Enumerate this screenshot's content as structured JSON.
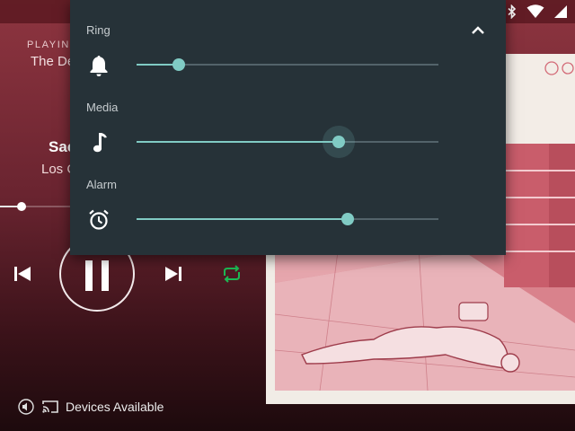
{
  "status_bar": {
    "icons": [
      "bluetooth-icon",
      "wifi-icon",
      "cellular-signal-icon"
    ]
  },
  "player": {
    "playing_from_label": "PLAYING",
    "playing_from_name": "The De",
    "track_title": "Sac",
    "track_artist": "Los C",
    "progress": 0.3,
    "repeat_color": "#1db954"
  },
  "bottom_bar": {
    "devices_label": "Devices Available"
  },
  "volume_panel": {
    "accent_color": "#80cbc4",
    "background_color": "#263238",
    "sliders": [
      {
        "label": "Ring",
        "icon": "bell-icon",
        "level": 0.14
      },
      {
        "label": "Media",
        "icon": "music-note-icon",
        "level": 0.67
      },
      {
        "label": "Alarm",
        "icon": "alarm-clock-icon",
        "level": 0.7
      }
    ]
  }
}
